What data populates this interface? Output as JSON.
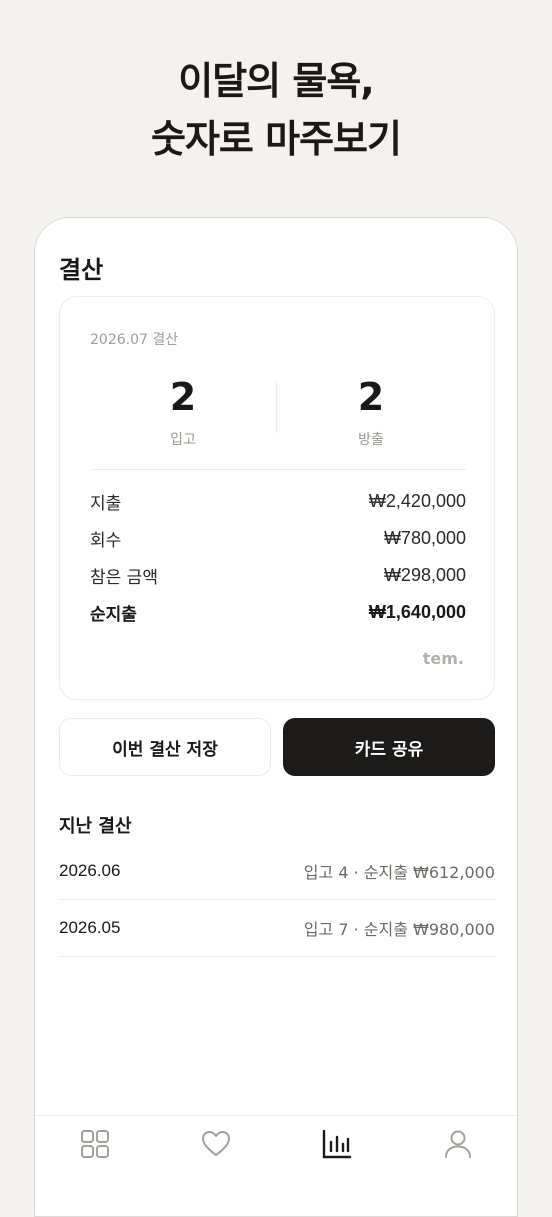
{
  "headline": {
    "line1": "이달의 물욕,",
    "line2": "숫자로 마주보기"
  },
  "screen": {
    "title": "결산"
  },
  "summary": {
    "period": "2026.07 결산",
    "stats": [
      {
        "value": "2",
        "label": "입고"
      },
      {
        "value": "2",
        "label": "방출"
      }
    ],
    "rows": [
      {
        "label": "지출",
        "value": "₩2,420,000"
      },
      {
        "label": "회수",
        "value": "₩780,000"
      },
      {
        "label": "참은 금액",
        "value": "₩298,000"
      },
      {
        "label": "순지출",
        "value": "₩1,640,000"
      }
    ],
    "brand": "tem."
  },
  "actions": {
    "save_label": "이번 결산 저장",
    "share_label": "카드 공유"
  },
  "history": {
    "title": "지난 결산",
    "items": [
      {
        "date": "2026.06",
        "summary": "입고 4 · 순지출 ₩612,000"
      },
      {
        "date": "2026.05",
        "summary": "입고 7 · 순지출 ₩980,000"
      }
    ]
  },
  "tabbar": {
    "items": [
      {
        "icon": "grid-icon",
        "active": false
      },
      {
        "icon": "heart-icon",
        "active": false
      },
      {
        "icon": "bar-chart-icon",
        "active": true
      },
      {
        "icon": "person-icon",
        "active": false
      }
    ]
  },
  "colors": {
    "background": "#f3f2ef",
    "accent": "#1c1b19",
    "muted": "#a09d97"
  }
}
